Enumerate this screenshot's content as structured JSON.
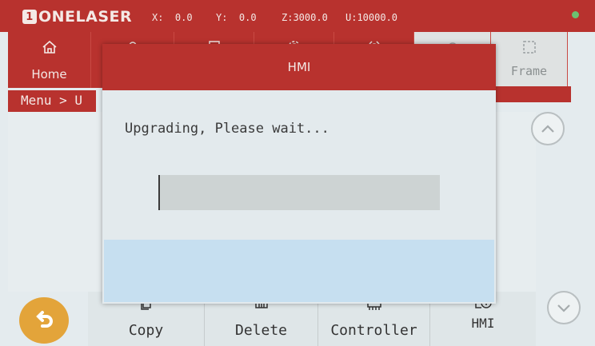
{
  "header": {
    "logo_mark": "1",
    "logo_text": "ONELASER",
    "coords": [
      {
        "label": "X:",
        "value": "0.0"
      },
      {
        "label": "Y:",
        "value": "0.0"
      },
      {
        "label": "Z:",
        "value": "3000.0"
      },
      {
        "label": "U:",
        "value": "10000.0"
      }
    ]
  },
  "nav": {
    "home_label": "Home",
    "frame_label": "Frame"
  },
  "breadcrumb": "Menu > U",
  "dialog": {
    "title": "HMI",
    "message": "Upgrading, Please wait...",
    "progress_fraction": 0.005
  },
  "bottom_bar": {
    "items": [
      {
        "label": "Copy",
        "icon": "copy-icon"
      },
      {
        "label": "Delete",
        "icon": "delete-icon"
      },
      {
        "label": "Controller",
        "icon": "controller-icon"
      },
      {
        "label": "HMI",
        "icon": "hmi-upgrade-icon"
      }
    ]
  },
  "colors": {
    "brand_red": "#b8322e",
    "back_button": "#e3a43a",
    "status_online": "#6cc070"
  }
}
